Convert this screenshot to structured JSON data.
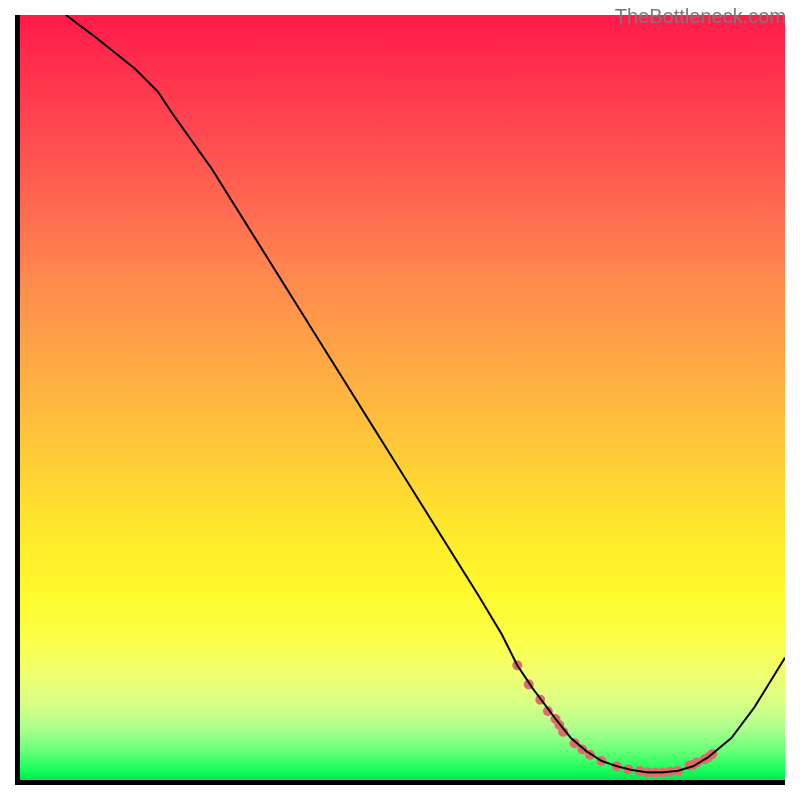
{
  "watermark": "TheBottleneck.com",
  "chart_data": {
    "type": "line",
    "title": "",
    "xlabel": "",
    "ylabel": "",
    "xlim": [
      0,
      100
    ],
    "ylim": [
      0,
      100
    ],
    "grid": false,
    "series": [
      {
        "name": "curve",
        "x": [
          6,
          10,
          15,
          18,
          20,
          25,
          30,
          35,
          40,
          45,
          50,
          55,
          60,
          63,
          65,
          67,
          70,
          72,
          74,
          76,
          78,
          80,
          82,
          84,
          86,
          88,
          90,
          93,
          96,
          100
        ],
        "y": [
          100,
          97,
          93,
          90,
          87,
          80,
          72,
          64,
          56,
          48,
          40,
          32,
          24,
          19,
          15,
          12,
          8,
          5.5,
          3.8,
          2.5,
          1.8,
          1.3,
          1.0,
          1.0,
          1.2,
          1.8,
          3.0,
          5.5,
          9.5,
          16
        ],
        "color": "#000000",
        "stroke_width": 2
      },
      {
        "name": "highlight-dots",
        "x": [
          65,
          66.5,
          68,
          69,
          70,
          70.5,
          71,
          72.5,
          73.5,
          74.5,
          76,
          78,
          79.5,
          81,
          82,
          83,
          84,
          85,
          86,
          87.5,
          88,
          88.5,
          89.5,
          90,
          90.5
        ],
        "y": [
          15,
          12.5,
          10.5,
          9,
          8,
          7.2,
          6.3,
          4.8,
          4.0,
          3.3,
          2.5,
          1.8,
          1.4,
          1.2,
          1.0,
          1.0,
          1.0,
          1.1,
          1.2,
          1.9,
          2.0,
          2.3,
          2.7,
          3.0,
          3.4
        ],
        "color": "#e46a6a",
        "marker_radius": 5
      }
    ],
    "background_gradient": {
      "direction": "vertical",
      "stops": [
        {
          "pos": 0.0,
          "color": "#ff1a4a"
        },
        {
          "pos": 0.34,
          "color": "#ff884e"
        },
        {
          "pos": 0.62,
          "color": "#ffd932"
        },
        {
          "pos": 0.82,
          "color": "#fbff4a"
        },
        {
          "pos": 0.93,
          "color": "#b0ff8e"
        },
        {
          "pos": 1.0,
          "color": "#00e94e"
        }
      ]
    }
  }
}
